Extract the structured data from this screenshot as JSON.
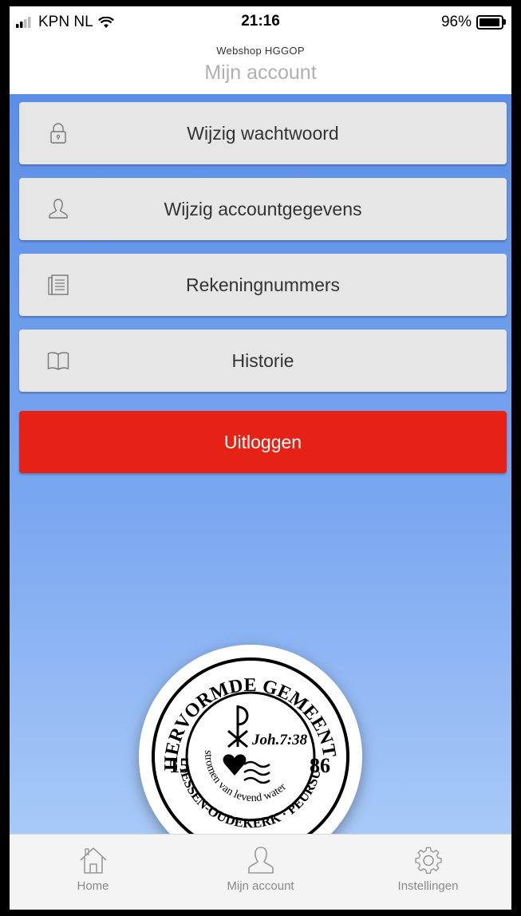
{
  "status_bar": {
    "carrier": "KPN NL",
    "time": "21:16",
    "battery": "96%",
    "battery_level": 0.96
  },
  "header": {
    "app_name": "Webshop HGGOP",
    "title": "Mijn account"
  },
  "menu": [
    {
      "label": "Wijzig wachtwoord",
      "icon": "lock-icon"
    },
    {
      "label": "Wijzig accountgegevens",
      "icon": "user-icon"
    },
    {
      "label": "Rekeningnummers",
      "icon": "document-icon"
    },
    {
      "label": "Historie",
      "icon": "book-icon"
    }
  ],
  "logout_label": "Uitloggen",
  "logo": {
    "top_text": "HERVORMDE GEMEENTE",
    "bottom_text": "GIESSEN-OUDEKERK · PEURSUM",
    "year_left": "15",
    "year_right": "86",
    "verse": "Joh.7:38",
    "motto": "stromen van levend water"
  },
  "tabs": [
    {
      "label": "Home",
      "icon": "home-icon"
    },
    {
      "label": "Mijn account",
      "icon": "user-icon"
    },
    {
      "label": "Instellingen",
      "icon": "gear-icon"
    }
  ],
  "colors": {
    "accent": "#5b8ee6",
    "logout": "#e52215",
    "button_bg": "#e6e6e6"
  }
}
